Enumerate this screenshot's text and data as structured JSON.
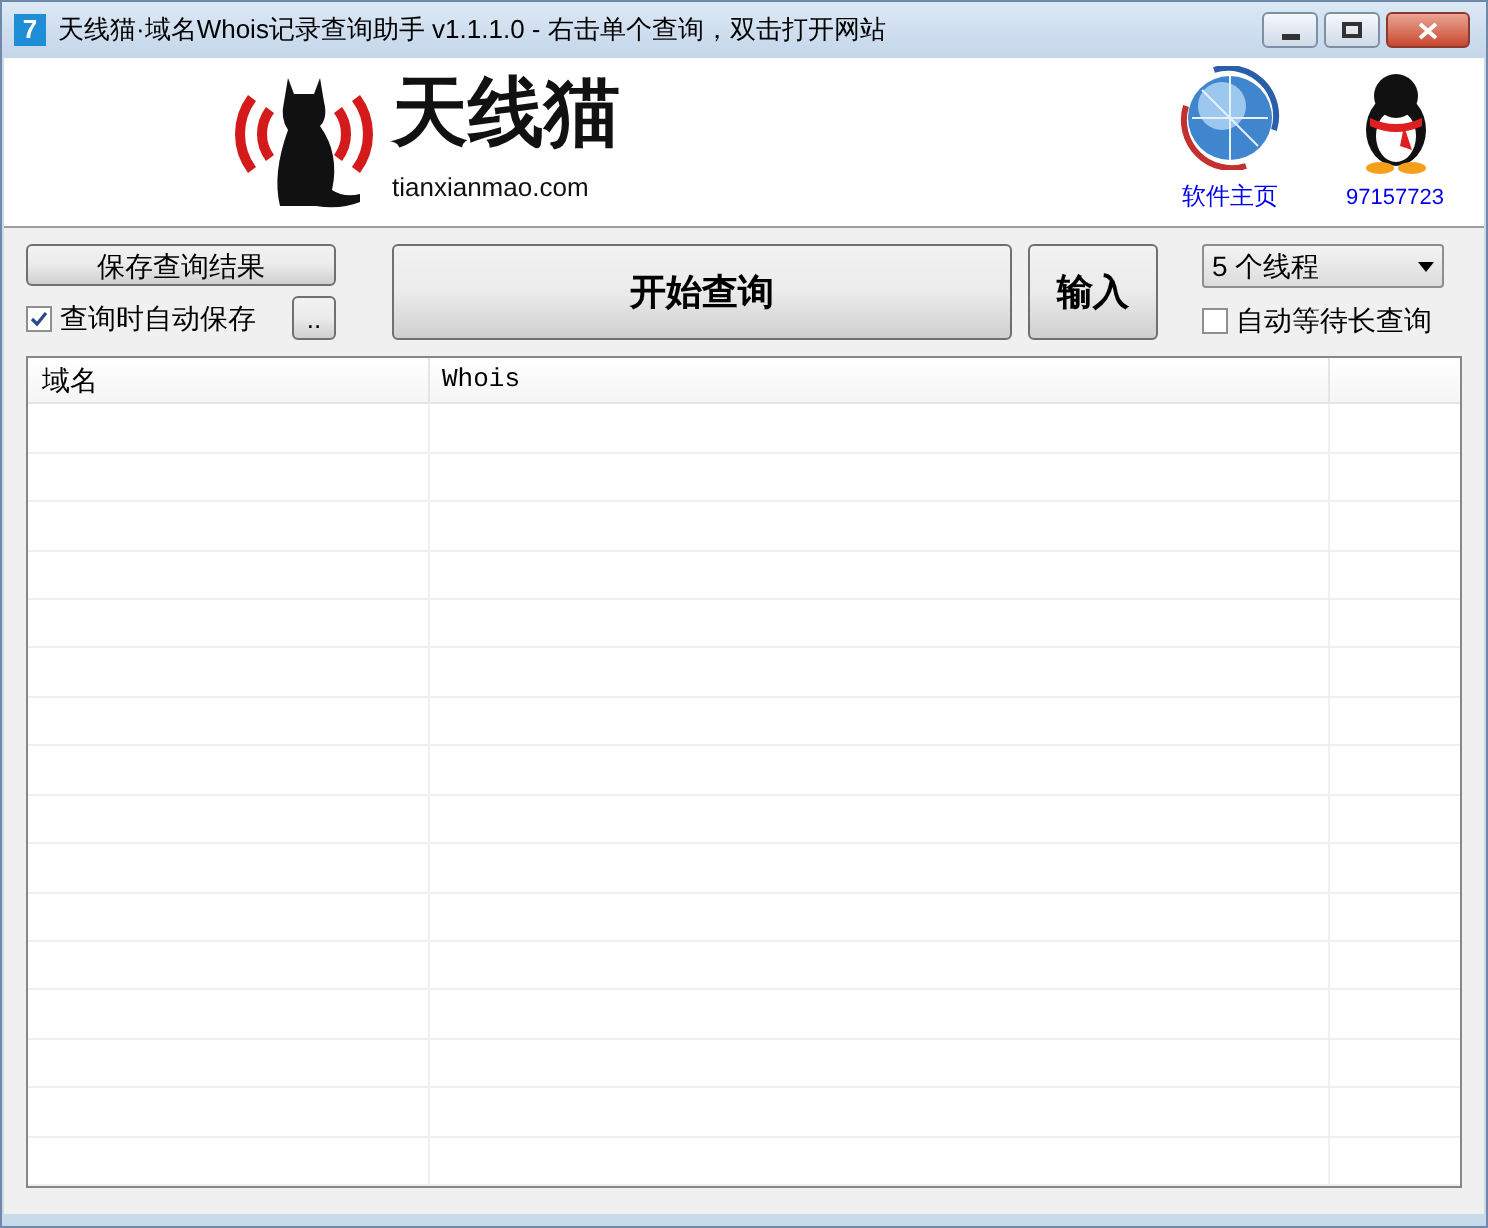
{
  "window": {
    "app_icon": "7",
    "title": "天线猫·域名Whois记录查询助手 v1.1.1.0 - 右击单个查询，双击打开网站"
  },
  "header": {
    "logo_text": "天线猫",
    "logo_domain": "tianxianmao.com",
    "links": [
      {
        "label": "软件主页"
      },
      {
        "label": "97157723"
      }
    ]
  },
  "toolbar": {
    "save_button": "保存查询结果",
    "auto_save": {
      "label": "查询时自动保存",
      "checked": true
    },
    "browse_button": "..",
    "start_button": "开始查询",
    "input_button": "输入",
    "threads": {
      "value": "5 个线程"
    },
    "wait_long": {
      "label": "自动等待长查询",
      "checked": false
    }
  },
  "table": {
    "columns": [
      "域名",
      "Whois"
    ]
  }
}
